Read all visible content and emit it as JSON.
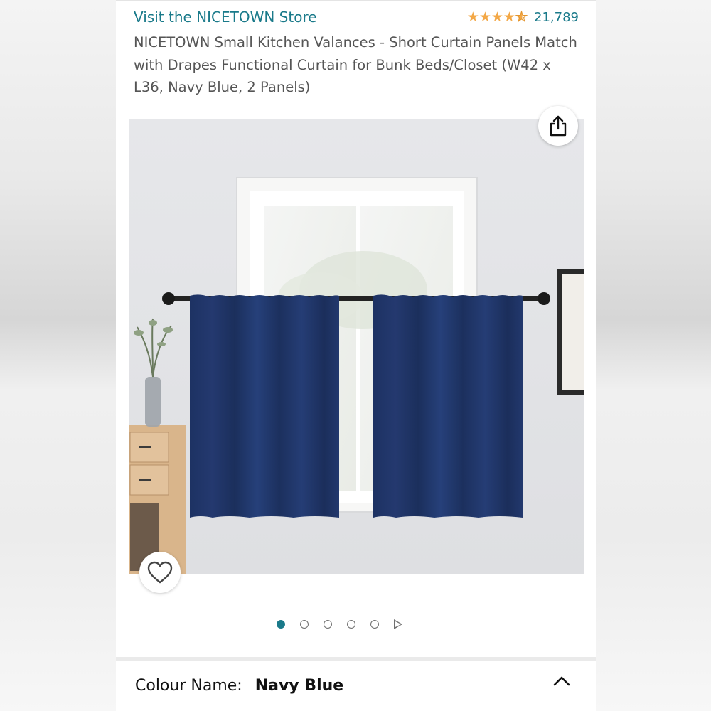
{
  "store": {
    "link_label": "Visit the NICETOWN Store"
  },
  "rating": {
    "stars": 4.5,
    "count": "21,789",
    "star_color": "#f3a847"
  },
  "product": {
    "title": "NICETOWN Small Kitchen Valances - Short Curtain Panels Match with Drapes Functional Curtain for Bunk Beds/Closet (W42 x L36, Navy Blue, 2 Panels)"
  },
  "gallery": {
    "image_count": 6,
    "active_index": 0,
    "share_icon": "share-icon",
    "wishlist_icon": "heart-icon",
    "next_icon": "play-arrow-icon"
  },
  "colour": {
    "label": "Colour Name:",
    "value": "Navy Blue",
    "toggle_icon": "chevron-up-icon"
  },
  "colors": {
    "accent": "#1a7a8a",
    "curtain": "#223a6e"
  }
}
